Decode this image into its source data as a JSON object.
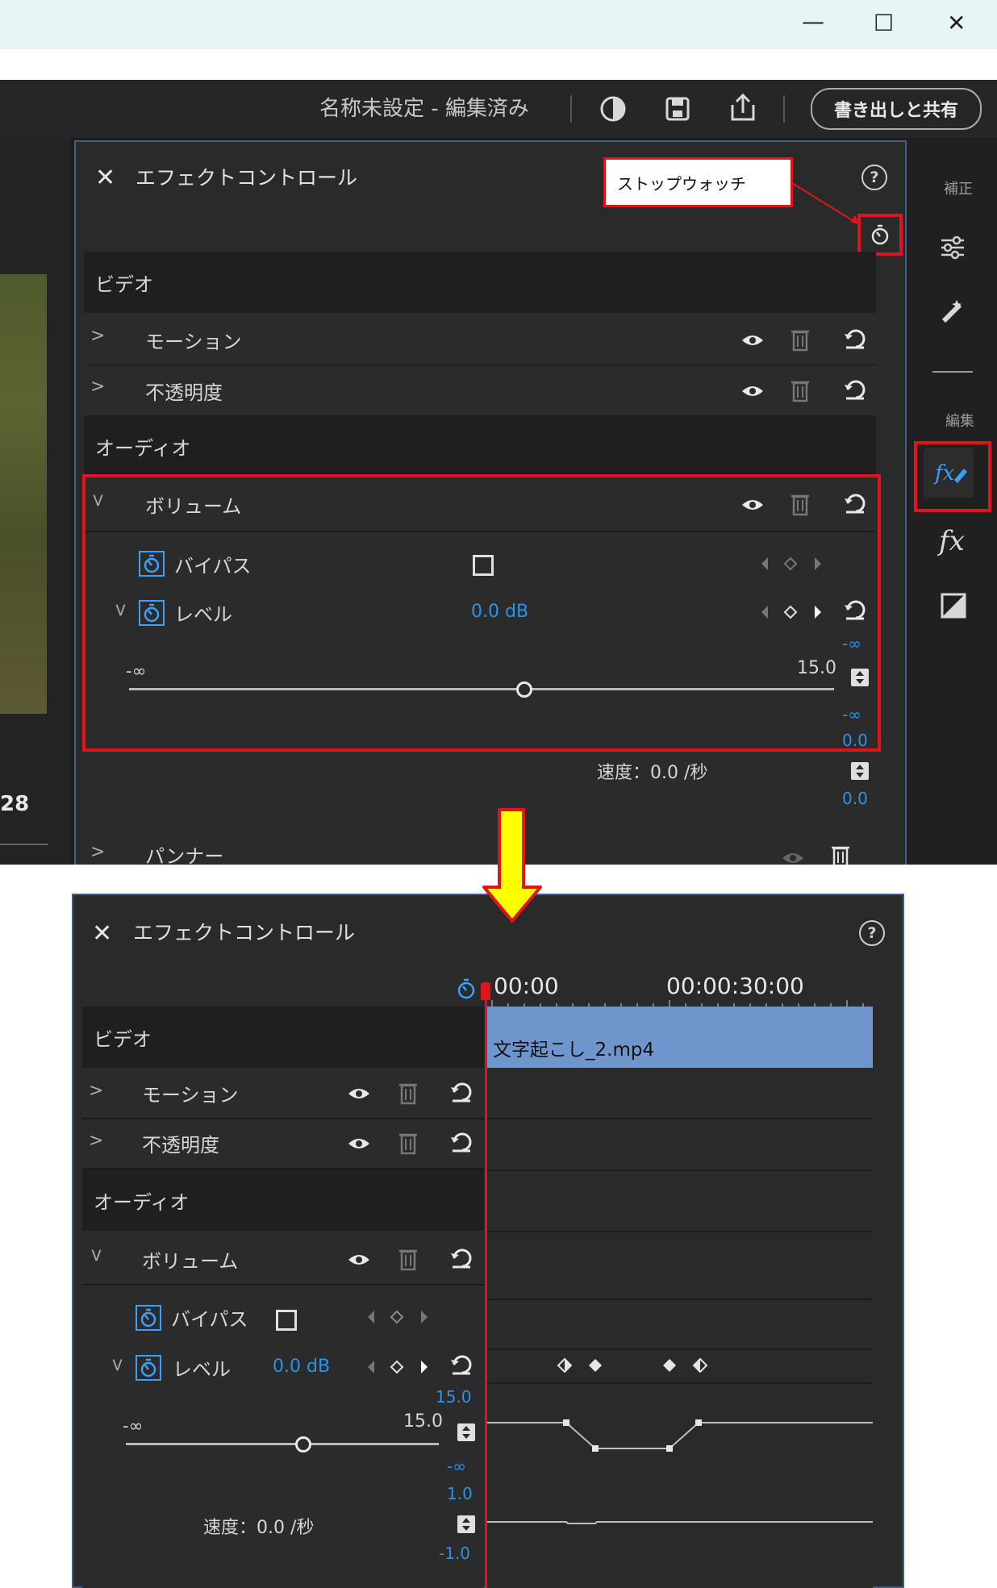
{
  "window": {
    "minimize": "—",
    "maximize": "☐",
    "close": "✕"
  },
  "topbar": {
    "doc_title": "名称未設定 - 編集済み",
    "export_label": "書き出しと共有"
  },
  "left_preview": {
    "time_fragment": "28"
  },
  "right_tools": {
    "correction_label": "補正",
    "edit_label": "編集"
  },
  "effect_panel_top": {
    "title": "エフェクトコントロール",
    "help": "?",
    "callout": "ストップウォッチ",
    "video_section": "ビデオ",
    "audio_section": "オーディオ",
    "motion": "モーション",
    "opacity": "不透明度",
    "volume": "ボリューム",
    "bypass": "バイパス",
    "level": "レベル",
    "level_value": "0.0 dB",
    "minus_inf": "-∞",
    "max_value": "15.0",
    "right_minus_inf_1": "-∞",
    "right_minus_inf_2": "-∞",
    "right_zero": "0.0",
    "speed": "速度：0.0 /秒",
    "speed_value": "0.0",
    "panner": "パンナー"
  },
  "effect_panel_bottom": {
    "title": "エフェクトコントロール",
    "help": "?",
    "time_start": "00:00",
    "time_mid": "00:00:30:00",
    "clip_name": "文字起こし_2.mp4",
    "video_section": "ビデオ",
    "audio_section": "オーディオ",
    "motion": "モーション",
    "opacity": "不透明度",
    "volume": "ボリューム",
    "bypass": "バイパス",
    "level": "レベル",
    "level_value": "0.0 dB",
    "graph_max": "15.0",
    "minus_inf": "-∞",
    "max_value": "15.0",
    "graph_min": "-∞",
    "speed_max": "1.0",
    "speed": "速度：0.0 /秒",
    "speed_min": "-1.0"
  },
  "colors": {
    "accent_blue": "#2b93e8",
    "highlight_red": "#e0141b",
    "arrow_yellow": "#ffff00",
    "clip_blue": "#6f96cc"
  }
}
